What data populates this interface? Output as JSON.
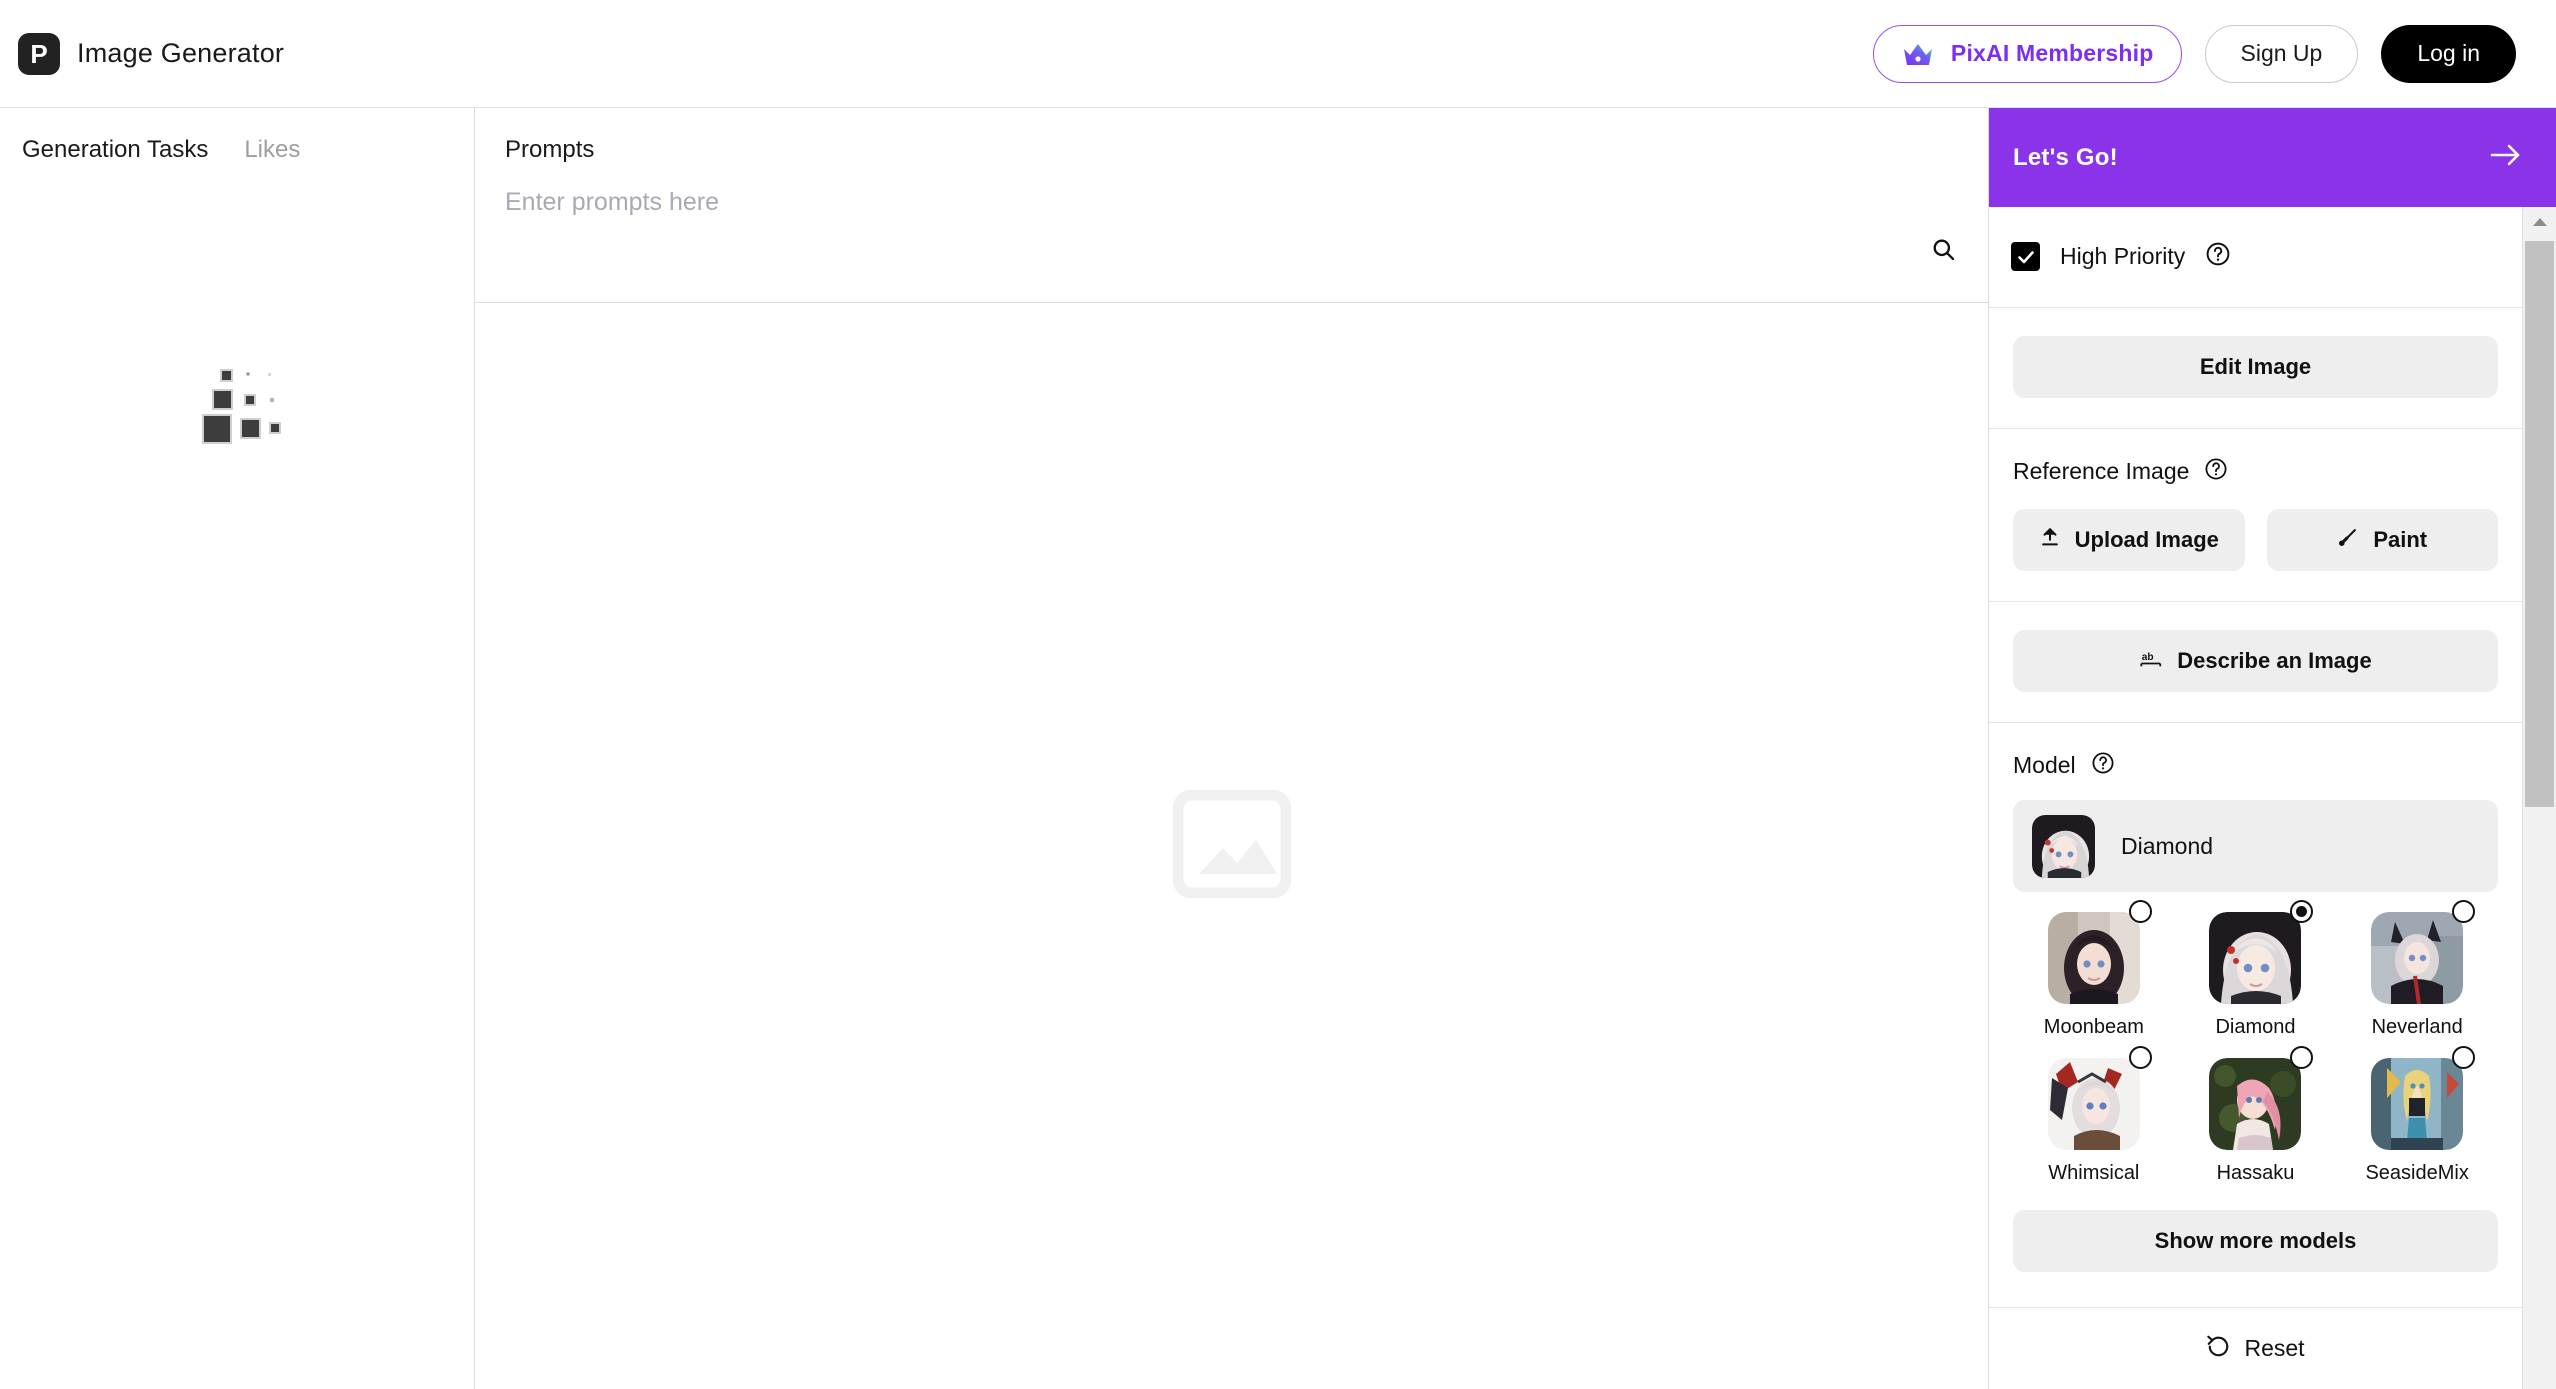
{
  "header": {
    "logo_letter": "P",
    "title": "Image Generator",
    "membership_label": "PixAI Membership",
    "signup_label": "Sign Up",
    "login_label": "Log in"
  },
  "sidebar": {
    "tabs": [
      {
        "label": "Generation Tasks",
        "active": true
      },
      {
        "label": "Likes",
        "active": false
      }
    ],
    "loading": true
  },
  "center": {
    "prompts_label": "Prompts",
    "prompt_value": "",
    "prompt_placeholder": "Enter prompts here",
    "search_icon": "search-icon",
    "placeholder_icon": "image-placeholder-icon"
  },
  "right_panel": {
    "lets_go_label": "Let's Go!",
    "lets_go_arrow_icon": "arrow-right-icon",
    "high_priority": {
      "label": "High Priority",
      "checked": true,
      "help_icon": "help-circle-icon"
    },
    "edit_image_label": "Edit Image",
    "reference_image": {
      "title": "Reference Image",
      "help_icon": "help-circle-icon",
      "upload_label": "Upload Image",
      "upload_icon": "upload-icon",
      "paint_label": "Paint",
      "paint_icon": "paintbrush-icon"
    },
    "describe_label": "Describe an Image",
    "describe_icon": "ab-text-icon",
    "model": {
      "title": "Model",
      "help_icon": "help-circle-icon",
      "selected": "Diamond",
      "options": [
        {
          "name": "Moonbeam",
          "selected": false
        },
        {
          "name": "Diamond",
          "selected": true
        },
        {
          "name": "Neverland",
          "selected": false
        },
        {
          "name": "Whimsical",
          "selected": false
        },
        {
          "name": "Hassaku",
          "selected": false
        },
        {
          "name": "SeasideMix",
          "selected": false
        }
      ],
      "show_more_label": "Show more models"
    },
    "reset_label": "Reset",
    "reset_icon": "rotate-ccw-icon"
  },
  "colors": {
    "accent_purple": "#8b33e8",
    "membership_text": "#7b2ff2",
    "login_bg": "#000000",
    "button_grey": "#eeeeee"
  }
}
